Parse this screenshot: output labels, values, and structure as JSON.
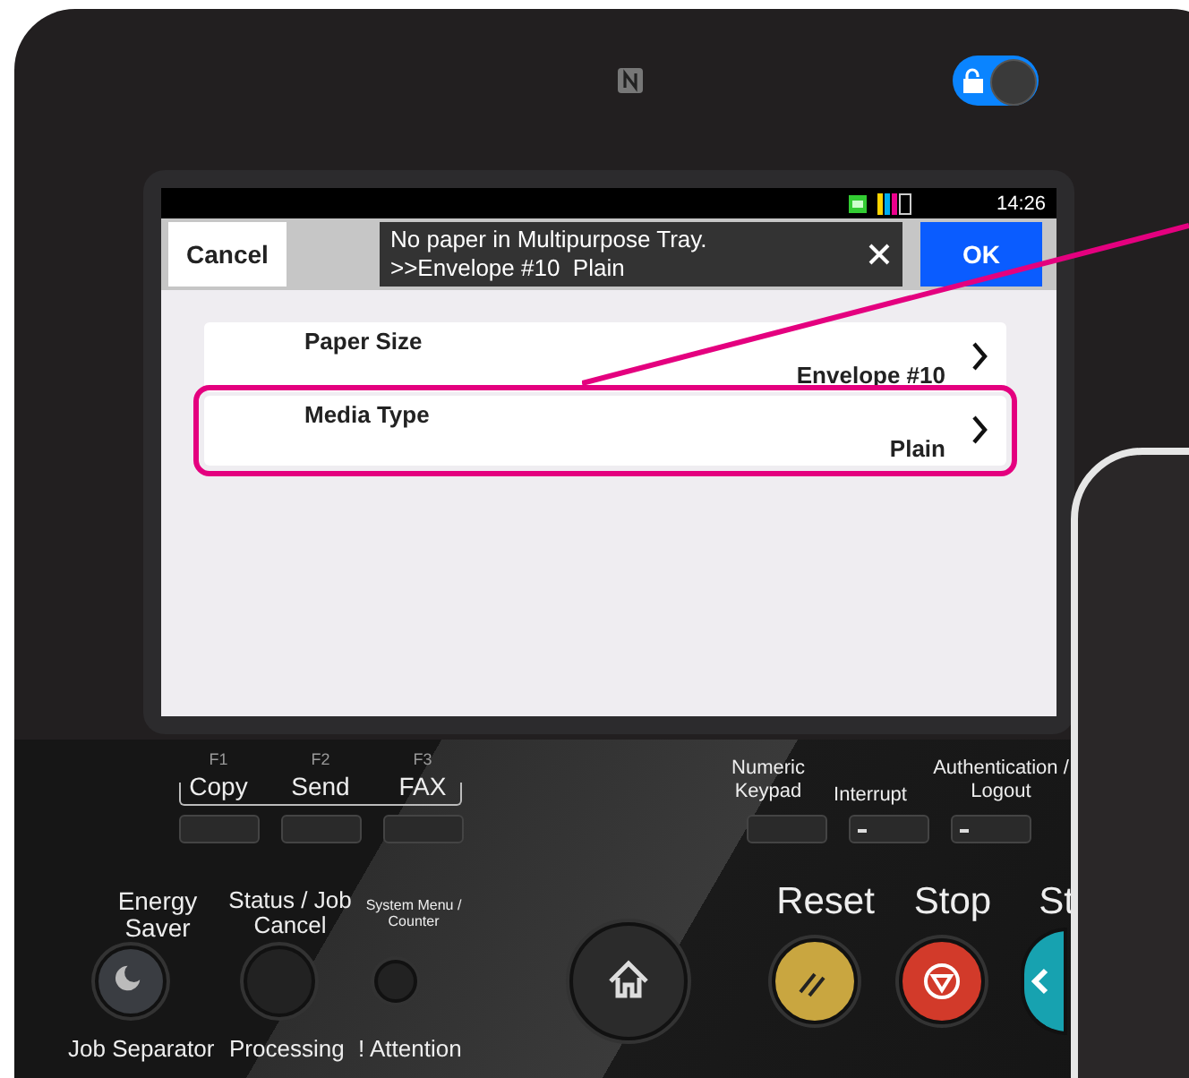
{
  "top": {
    "lock_switch": {
      "on": true
    }
  },
  "screen": {
    "status_bar": {
      "time": "14:26"
    },
    "cancel_button": "Cancel",
    "message": [
      "No paper in Multipurpose Tray.",
      ">>Envelope #10  Plain"
    ],
    "ok_button": "OK",
    "settings": [
      {
        "label": "Paper Size",
        "value": "Envelope #10",
        "highlighted": false
      },
      {
        "label": "Media Type",
        "value": "Plain",
        "highlighted": true
      }
    ]
  },
  "panel": {
    "function_keys": [
      {
        "key": "F1",
        "label": "Copy"
      },
      {
        "key": "F2",
        "label": "Send"
      },
      {
        "key": "F3",
        "label": "FAX"
      }
    ],
    "right_keys": [
      {
        "label": "Numeric Keypad",
        "indicator": false
      },
      {
        "label": "Interrupt",
        "indicator": true
      },
      {
        "label": "Authentication / Logout",
        "indicator": true
      }
    ],
    "round_buttons": [
      {
        "kind": "energy",
        "label": "Energy Saver"
      },
      {
        "kind": "status",
        "label": "Status / Job Cancel"
      },
      {
        "kind": "small",
        "label": "System Menu / Counter"
      },
      {
        "kind": "home"
      },
      {
        "kind": "reset",
        "label": "Reset"
      },
      {
        "kind": "stop",
        "label": "Stop"
      },
      {
        "kind": "start",
        "label": "St"
      }
    ],
    "indicators": [
      "Job Separator",
      "Processing",
      "! Attention"
    ]
  }
}
